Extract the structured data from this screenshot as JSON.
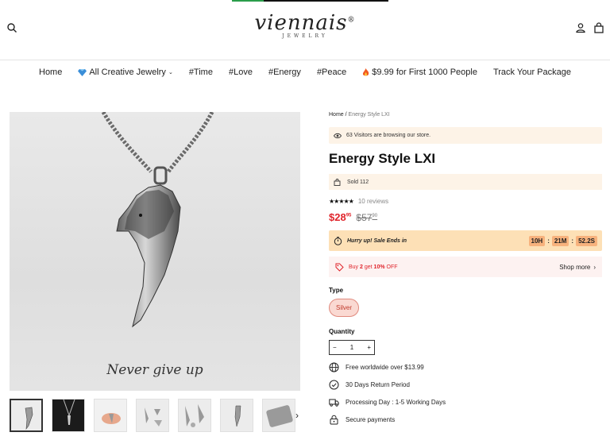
{
  "header": {
    "logo_text": "viennais",
    "logo_mark": "®",
    "logo_sub": "JEWELRY",
    "icons": [
      "search-icon",
      "account-icon",
      "cart-icon"
    ]
  },
  "nav": {
    "items": [
      {
        "label": "Home"
      },
      {
        "label": "All Creative Jewelry",
        "icon": "diamond-icon",
        "dropdown": true
      },
      {
        "label": "#Time"
      },
      {
        "label": "#Love"
      },
      {
        "label": "#Energy"
      },
      {
        "label": "#Peace"
      },
      {
        "label": "$9.99 for First 1000 People",
        "icon": "fire-icon"
      },
      {
        "label": "Track Your Package"
      }
    ]
  },
  "gallery": {
    "caption": "Never give up",
    "thumb_count": 7,
    "next_icon": "chevron-right-icon"
  },
  "product": {
    "breadcrumb_home": "Home",
    "breadcrumb_sep": " / ",
    "breadcrumb_current": "Energy Style LXI",
    "visitors_text": "63 Visitors are browsing our store.",
    "title": "Energy Style LXI",
    "sold_text": "Sold 112",
    "rating_stars": "★★★★★",
    "reviews_text": "10 reviews",
    "price_now": "$28",
    "price_now_cents": "95",
    "price_old": "$57",
    "price_old_cents": "90",
    "sale_text": "Hurry up! Sale Ends in",
    "timer": {
      "hours": "10H",
      "minutes": "21M",
      "seconds": "52.2S",
      "sep": ":"
    },
    "offer_prefix": "Buy ",
    "offer_qty": "2",
    "offer_mid": " get ",
    "offer_pct": "10%",
    "offer_suffix": " OFF",
    "shop_more": "Shop more",
    "type_label": "Type",
    "variant": "Silver",
    "qty_label": "Quantity",
    "qty_minus": "−",
    "qty_value": "1",
    "qty_plus": "+",
    "features": [
      {
        "icon": "globe-icon",
        "text": "Free worldwide over $13.99"
      },
      {
        "icon": "check-circle-icon",
        "text": "30 Days Return Period"
      },
      {
        "icon": "truck-icon",
        "text": "Processing Day : 1-5 Working Days"
      },
      {
        "icon": "lock-icon",
        "text": "Secure payments"
      }
    ]
  },
  "colors": {
    "price": "#e0242b",
    "notice_bg": "#fdf3e7",
    "sale_bg": "#fde0b6",
    "timer_bg": "#f7b27d",
    "variant_bg": "#fad9d2"
  }
}
